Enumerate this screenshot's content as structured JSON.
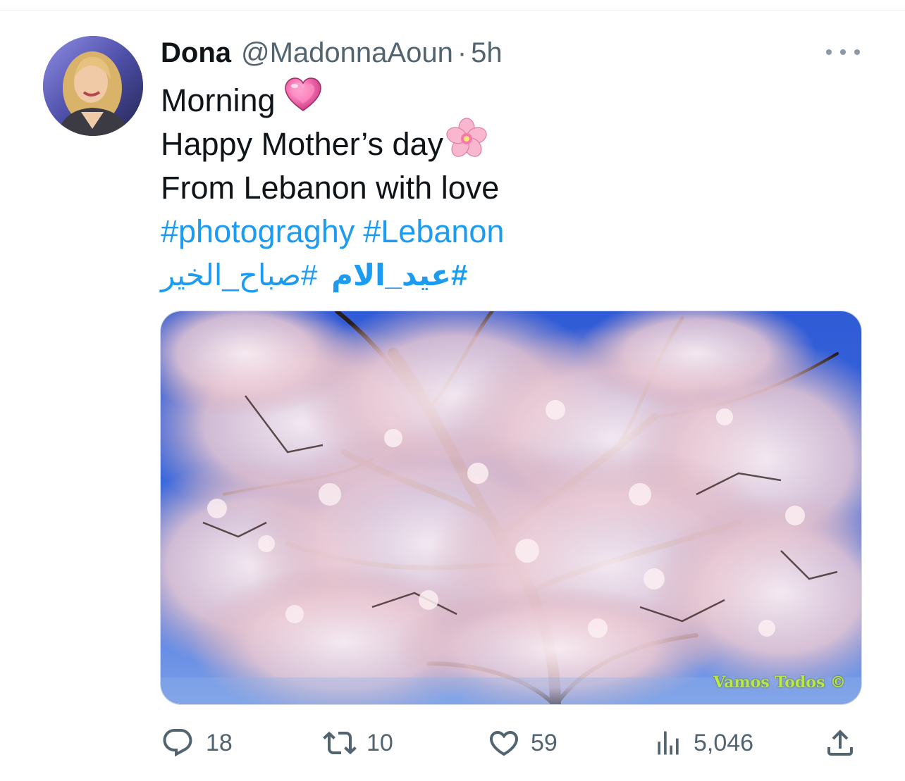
{
  "tweet": {
    "display_name": "Dona",
    "handle": "@MadonnaAoun",
    "separator": "·",
    "time": "5h",
    "lines": {
      "line1": "Morning",
      "line2": "Happy Mother’s day",
      "line3": "From Lebanon with love"
    },
    "hashtags": {
      "tag1": "#photograghy",
      "tag2": "#Lebanon",
      "tag3": "#عيد_الام",
      "tag4": "#صباح_الخير"
    },
    "emoji": {
      "heart": "pink-heart-icon",
      "flower": "cherry-blossom-icon"
    },
    "media": {
      "watermark": "Vamos Todos ©"
    },
    "actions": {
      "replies": "18",
      "retweets": "10",
      "likes": "59",
      "views": "5,046"
    }
  },
  "colors": {
    "link": "#1d9bf0",
    "secondary_text": "#536471",
    "primary_text": "#0f1419",
    "sky": "#2f5bd6",
    "blossom": "#f1d4dc"
  }
}
